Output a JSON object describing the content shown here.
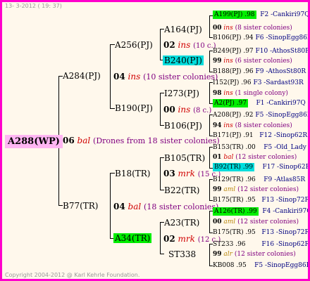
{
  "header": {
    "date": "13- 3-2012 ( 19: 37)"
  },
  "footer": {
    "copyright": "Copyright 2004-2012 @ Karl Kehrle Foundation."
  },
  "root": {
    "name": "A288(WP)",
    "year": "06",
    "mark": "bal",
    "note": "(Drones from 18 sister colonies)"
  },
  "gen1": [
    {
      "name": "A284(PJ)",
      "year": "04",
      "mark": "ins",
      "note": "(10 sister colonies)"
    },
    {
      "name": "B77(TR)",
      "year": "04",
      "mark": "bal",
      "note": "(18 sister colonies)"
    }
  ],
  "gen2": [
    {
      "name": "A256(PJ)",
      "year": "02",
      "mark": "ins",
      "note": "(10 c.)"
    },
    {
      "name": "B190(PJ)",
      "year": "00",
      "mark": "ins",
      "note": "(8 c.)"
    },
    {
      "name": "B18(TR)",
      "year": "03",
      "mark": "mrk",
      "note": "(15 c.)"
    },
    {
      "name": "A34(TR)",
      "year": "02",
      "mark": "mrk",
      "note": "(12 c.)"
    }
  ],
  "gen3": [
    {
      "name": "A164(PJ)"
    },
    {
      "name": "B240(PJ)"
    },
    {
      "name": "I273(PJ)"
    },
    {
      "name": "B106(PJ)"
    },
    {
      "name": "B105(TR)"
    },
    {
      "name": "B22(TR)"
    },
    {
      "name": "A23(TR)"
    },
    {
      "name": "ST338"
    }
  ],
  "gen4": [
    {
      "a": "A199(PJ) .98",
      "b": "F2 -Cankiri97Q"
    },
    {
      "a": "00",
      "m": "ins",
      "c": "(8 sister colonies)"
    },
    {
      "a": "B106(PJ) .94",
      "b": "F6 -SinopEgg86R"
    },
    {
      "a": "B249(PJ) .97",
      "b": "F10 -AthosSt80R"
    },
    {
      "a": "99",
      "m": "ins",
      "c": "(6 sister colonies)"
    },
    {
      "a": "B188(PJ) .96",
      "b": "F9 -AthosSt80R"
    },
    {
      "a": "I152(PJ) .96",
      "b": "F3 -Sardast93R"
    },
    {
      "a": "98",
      "m": "ins",
      "c": "(1 single colony)"
    },
    {
      "a": "A2(PJ) .97",
      "b": "F1 -Cankiri97Q"
    },
    {
      "a": "A208(PJ) .92",
      "b": "F5 -SinopEgg86R"
    },
    {
      "a": "94",
      "m": "ins",
      "c": "(8 sister colonies)"
    },
    {
      "a": "B171(PJ) .91",
      "b": "F12 -Sinop62R"
    },
    {
      "a": "B153(TR) .00",
      "b": "F5 -Old_Lady"
    },
    {
      "a": "01",
      "m": "bal",
      "c": "(12 sister colonies)"
    },
    {
      "a": "B92(TR) .99",
      "b": "F17 -Sinop62R"
    },
    {
      "a": "B129(TR) .96",
      "b": "F9 -Atlas85R"
    },
    {
      "a": "99",
      "m": "aml",
      "c": "(12 sister colonies)"
    },
    {
      "a": "B175(TR) .95",
      "b": "F13 -Sinop72R"
    },
    {
      "a": "A126(TR) .99",
      "b": "F4 -Cankiri97Q"
    },
    {
      "a": "00",
      "m": "aml",
      "c": "(12 sister colonies)"
    },
    {
      "a": "B175(TR) .95",
      "b": "F13 -Sinop72R"
    },
    {
      "a": "ST233 .96",
      "b": "F16 -Sinop62R"
    },
    {
      "a": "99",
      "m": "alr",
      "c": "(12 sister colonies)"
    },
    {
      "a": "KB008 .95",
      "b": "F5 -SinopEgg86R"
    }
  ]
}
